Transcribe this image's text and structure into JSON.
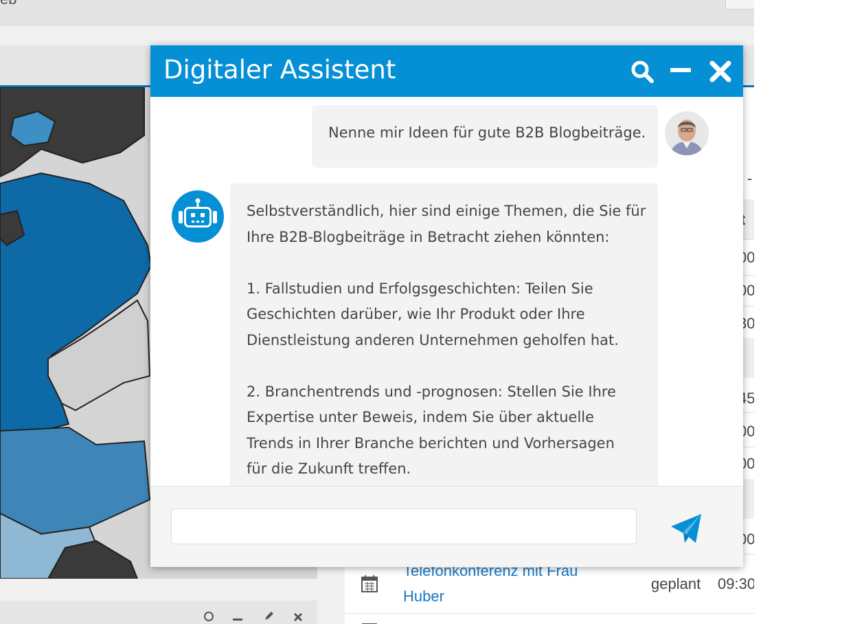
{
  "background": {
    "topbar_text": "eb",
    "right_rows": [
      {
        "cell": "t"
      },
      {
        "cell": "00"
      },
      {
        "cell": "00"
      },
      {
        "cell": "30"
      },
      {
        "cell": "45"
      },
      {
        "cell": "00"
      },
      {
        "cell": "00"
      },
      {
        "cell": "00"
      }
    ],
    "task": {
      "title_line1": "Telefonkonferenz mit Frau",
      "title_line2": "Huber",
      "status": "geplant",
      "time": "09:30"
    },
    "dash": "-"
  },
  "dialog": {
    "title": "Digitaler Assistent",
    "accent_color": "#0590d6",
    "messages": {
      "user": {
        "text": "Nenne mir Ideen für gute B2B Blogbeiträge."
      },
      "bot": {
        "intro_line1": "Selbstverständlich, hier sind einige Themen, die Sie für",
        "intro_line2": "Ihre B2B-Blogbeiträge in Betracht ziehen könnten:",
        "item1_line1": "1. Fallstudien und Erfolgsgeschichten: Teilen Sie",
        "item1_line2": "Geschichten darüber, wie Ihr Produkt oder Ihre",
        "item1_line3": "Dienstleistung anderen Unternehmen geholfen hat.",
        "item2_line1": "2. Branchentrends und -prognosen: Stellen Sie Ihre",
        "item2_line2": "Expertise unter Beweis, indem Sie über aktuelle",
        "item2_line3": "Trends in Ihrer Branche berichten und Vorhersagen",
        "item2_line4": "für die Zukunft treffen."
      }
    },
    "composer": {
      "value": "",
      "placeholder": ""
    },
    "icons": {
      "search": "search-icon",
      "minimize": "minimize-icon",
      "close": "close-icon",
      "send": "send-icon",
      "bot": "robot-icon"
    }
  }
}
